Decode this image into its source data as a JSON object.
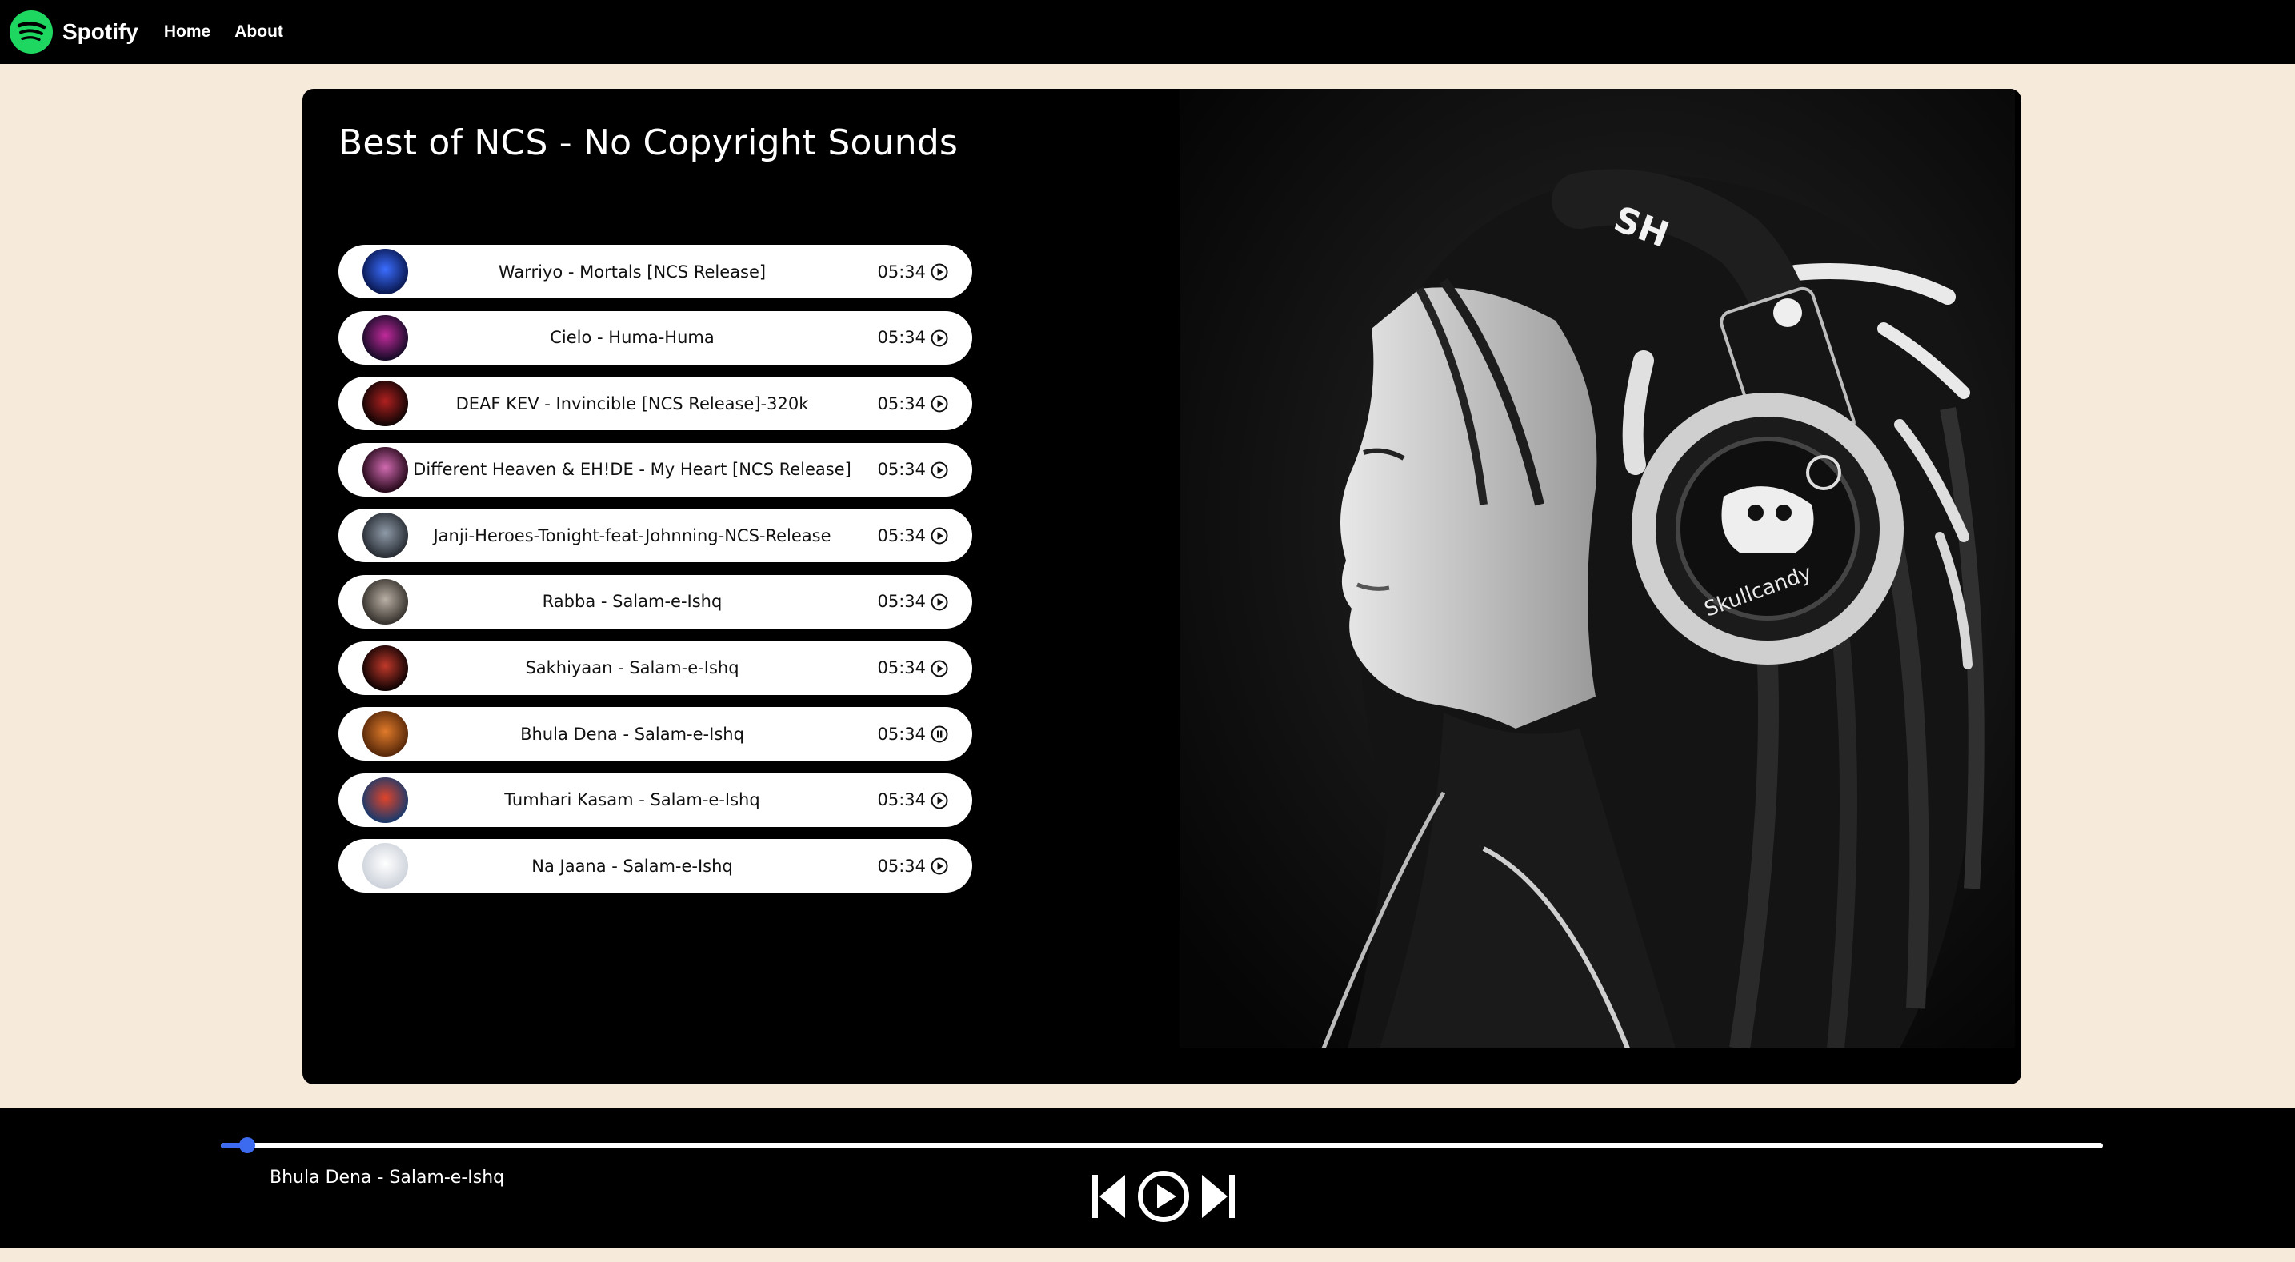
{
  "nav": {
    "brand": "Spotify",
    "links": [
      "Home",
      "About"
    ]
  },
  "colors": {
    "brand_green": "#1ed760",
    "progress": "#3d6bf0",
    "background": "#f6eadb"
  },
  "playlist": {
    "title": "Best of NCS - No Copyright Sounds",
    "songs": [
      {
        "name": "Warriyo - Mortals [NCS Release]",
        "duration": "05:34",
        "icon": "play-circle-icon",
        "cover": [
          "#0a1a55",
          "#3b6dff"
        ]
      },
      {
        "name": "Cielo - Huma-Huma",
        "duration": "05:34",
        "icon": "play-circle-icon",
        "cover": [
          "#1a0b2a",
          "#c02a9a"
        ]
      },
      {
        "name": "DEAF KEV - Invincible [NCS Release]-320k",
        "duration": "05:34",
        "icon": "play-circle-icon",
        "cover": [
          "#140505",
          "#b02020"
        ]
      },
      {
        "name": "Different Heaven & EH!DE - My Heart [NCS Release]",
        "duration": "05:34",
        "icon": "play-circle-icon",
        "cover": [
          "#2a0b1e",
          "#d06ab0"
        ]
      },
      {
        "name": "Janji-Heroes-Tonight-feat-Johnning-NCS-Release",
        "duration": "05:34",
        "icon": "play-circle-icon",
        "cover": [
          "#2a2f36",
          "#8e9aa8"
        ]
      },
      {
        "name": "Rabba - Salam-e-Ishq",
        "duration": "05:34",
        "icon": "play-circle-icon",
        "cover": [
          "#3a3530",
          "#b9b0a5"
        ]
      },
      {
        "name": "Sakhiyaan - Salam-e-Ishq",
        "duration": "05:34",
        "icon": "play-circle-icon",
        "cover": [
          "#120303",
          "#c0392b"
        ]
      },
      {
        "name": "Bhula Dena - Salam-e-Ishq",
        "duration": "05:34",
        "icon": "pause-circle-icon",
        "cover": [
          "#5a2a0a",
          "#e07a2a"
        ]
      },
      {
        "name": "Tumhari Kasam - Salam-e-Ishq",
        "duration": "05:34",
        "icon": "play-circle-icon",
        "cover": [
          "#1e3a6a",
          "#e0442a"
        ]
      },
      {
        "name": "Na Jaana - Salam-e-Ishq",
        "duration": "05:34",
        "icon": "play-circle-icon",
        "cover": [
          "#cfd4dc",
          "#ffffff"
        ]
      }
    ]
  },
  "player": {
    "now_playing": "Bhula Dena - Salam-e-Ishq",
    "progress": 0.014,
    "controls": [
      "skip-previous-icon",
      "play-circle-icon",
      "skip-next-icon"
    ]
  }
}
